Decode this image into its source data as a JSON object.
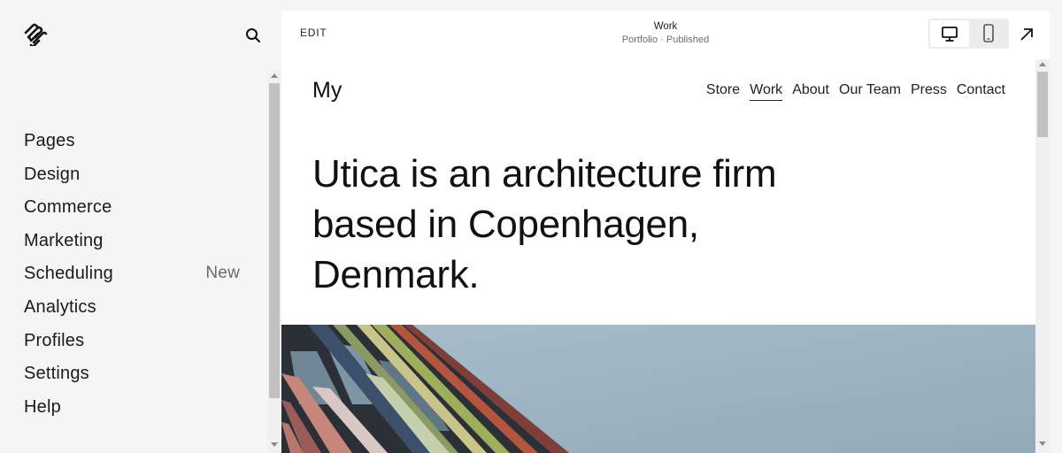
{
  "sidebar": {
    "logo_icon": "squarespace-logo-icon",
    "search_icon": "search-icon",
    "items": [
      {
        "label": "Pages"
      },
      {
        "label": "Design"
      },
      {
        "label": "Commerce"
      },
      {
        "label": "Marketing"
      },
      {
        "label": "Scheduling",
        "badge": "New"
      },
      {
        "label": "Analytics"
      },
      {
        "label": "Profiles"
      },
      {
        "label": "Settings"
      },
      {
        "label": "Help"
      }
    ]
  },
  "toolbar": {
    "edit_label": "EDIT",
    "page_title": "Work",
    "page_subtitle": "Portfolio · Published",
    "desktop_icon": "desktop-icon",
    "mobile_icon": "mobile-icon",
    "expand_icon": "arrow-up-right-icon"
  },
  "site": {
    "logo_text": "My",
    "nav": [
      {
        "label": "Store"
      },
      {
        "label": "Work",
        "active": true
      },
      {
        "label": "About"
      },
      {
        "label": "Our Team"
      },
      {
        "label": "Press"
      },
      {
        "label": "Contact"
      }
    ],
    "hero_lines": [
      "Utica is an architecture firm",
      "based in Copenhagen,",
      "Denmark."
    ]
  },
  "colors": {
    "sidebar_bg": "#f5f5f5",
    "sky": "#9fb4c2"
  }
}
